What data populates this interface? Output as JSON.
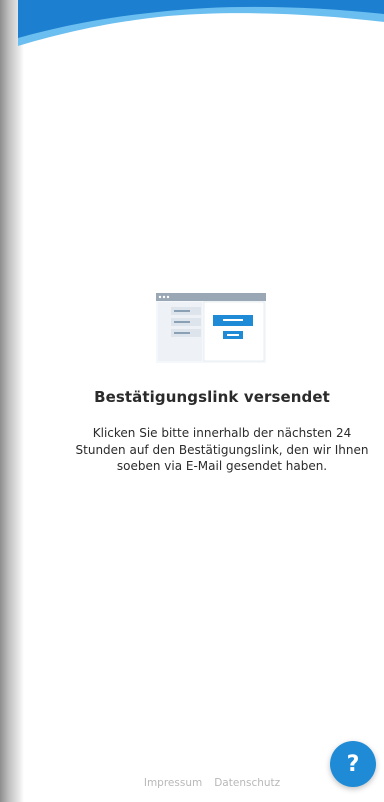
{
  "colors": {
    "accent": "#1f8bd6",
    "wave_dark": "#1c7fcf",
    "wave_light": "#6bbef0",
    "text": "#2b2b2b",
    "footer_text": "#b8b8b8"
  },
  "illustration": {
    "icon": "browser-window-illustration-icon"
  },
  "content": {
    "title": "Bestätigungslink versendet",
    "message": "Klicken Sie bitte innerhalb der nächsten 24 Stunden auf den Bestätigungslink, den wir Ihnen soeben via E-Mail gesendet haben."
  },
  "footer": {
    "impressum_label": "Impressum",
    "datenschutz_label": "Datenschutz"
  },
  "help": {
    "label": "?",
    "icon": "question-mark-icon"
  }
}
